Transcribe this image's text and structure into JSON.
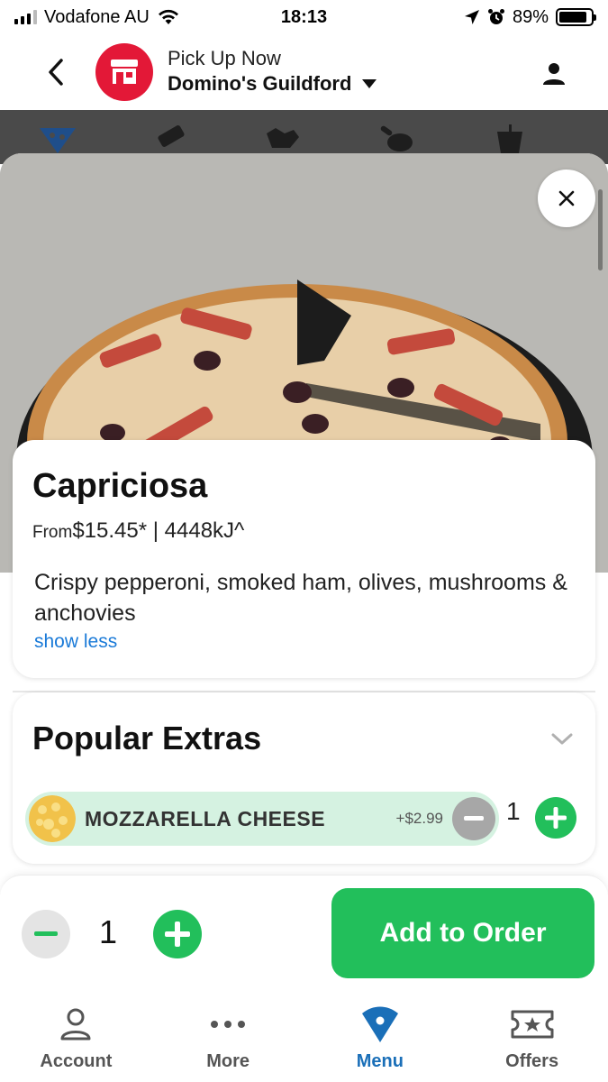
{
  "status_bar": {
    "carrier": "Vodafone AU",
    "time": "18:13",
    "battery": "89%",
    "battery_level": 0.89
  },
  "header": {
    "subtitle": "Pick Up Now",
    "store": "Domino's Guildford"
  },
  "product": {
    "name": "Capriciosa",
    "price_prefix": "From",
    "price": "$15.45*",
    "separator": "|",
    "energy": "4448kJ^",
    "description": "Crispy pepperoni, smoked ham, olives, mushrooms & anchovies",
    "toggle_label": "show less"
  },
  "extras": {
    "title": "Popular Extras",
    "items": [
      {
        "name": "MOZZARELLA CHEESE",
        "price": "+$2.99",
        "quantity": "1"
      }
    ]
  },
  "order": {
    "quantity": "1",
    "add_label": "Add to Order"
  },
  "tabs": [
    {
      "label": "Account",
      "icon": "account-icon",
      "active": false
    },
    {
      "label": "More",
      "icon": "more-icon",
      "active": false
    },
    {
      "label": "Menu",
      "icon": "menu-pizza-icon",
      "active": true
    },
    {
      "label": "Offers",
      "icon": "offers-ticket-icon",
      "active": false
    }
  ],
  "colors": {
    "brand_red": "#e31837",
    "action_green": "#22bf5b",
    "extra_highlight": "#d5f2e1",
    "link_blue": "#1a7ad8",
    "tab_active": "#1a6fb8"
  }
}
